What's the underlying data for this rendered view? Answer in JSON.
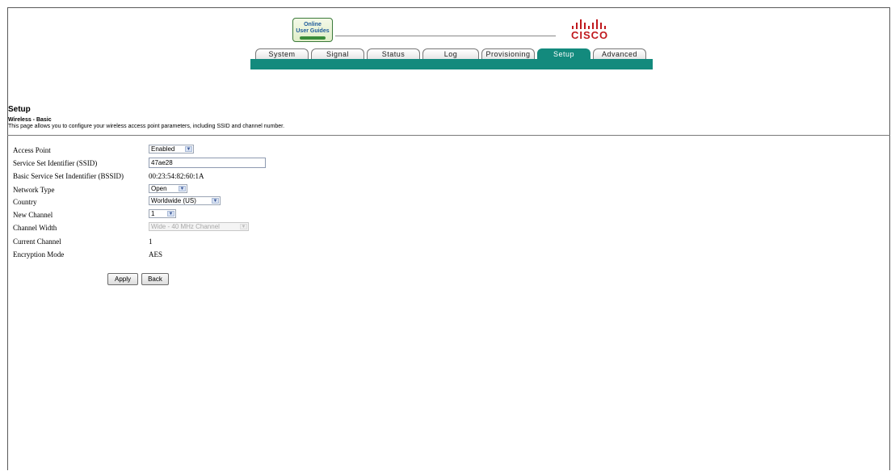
{
  "header": {
    "guides_logo": [
      "Online",
      "User Guides"
    ],
    "cisco_logo_text": "CISCO",
    "tabs": [
      {
        "label": "System"
      },
      {
        "label": "Signal"
      },
      {
        "label": "Status"
      },
      {
        "label": "Log"
      },
      {
        "label": "Provisioning"
      },
      {
        "label": "Setup"
      },
      {
        "label": "Advanced"
      }
    ],
    "active_tab": "Setup",
    "accent_color": "#138a7d",
    "brand_color": "#c0191e"
  },
  "page": {
    "title": "Setup",
    "subtitle": "Wireless - Basic",
    "description": "This page allows you to configure your wireless access point parameters, including SSID and channel number."
  },
  "form": {
    "access_point": {
      "label": "Access Point",
      "value": "Enabled"
    },
    "ssid": {
      "label": "Service Set Identifier (SSID)",
      "value": "47ae28"
    },
    "bssid": {
      "label": "Basic Service Set Indentifier (BSSID)",
      "value": "00:23:54:82:60:1A"
    },
    "network_type": {
      "label": "Network Type",
      "value": "Open"
    },
    "country": {
      "label": "Country",
      "value": "Worldwide (US)"
    },
    "new_channel": {
      "label": "New Channel",
      "value": "1"
    },
    "channel_width": {
      "label": "Channel Width",
      "value": "Wide - 40 MHz Channel"
    },
    "current_channel": {
      "label": "Current Channel",
      "value": "1"
    },
    "encryption_mode": {
      "label": "Encryption Mode",
      "value": "AES"
    }
  },
  "buttons": {
    "apply": "Apply",
    "back": "Back"
  }
}
